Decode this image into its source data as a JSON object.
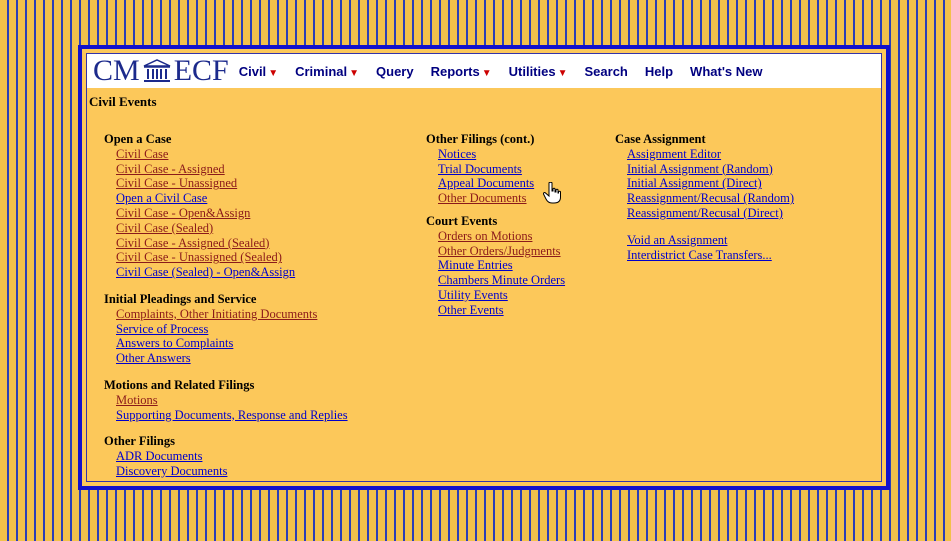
{
  "logo": {
    "left_text": "CM",
    "right_text": "ECF"
  },
  "menu": [
    {
      "label": "Civil",
      "has_caret": true
    },
    {
      "label": "Criminal",
      "has_caret": true
    },
    {
      "label": "Query",
      "has_caret": false
    },
    {
      "label": "Reports",
      "has_caret": true
    },
    {
      "label": "Utilities",
      "has_caret": true
    },
    {
      "label": "Search",
      "has_caret": false
    },
    {
      "label": "Help",
      "has_caret": false
    },
    {
      "label": "What's New",
      "has_caret": false
    }
  ],
  "page_title": "Civil Events",
  "col1": {
    "open_case": {
      "heading": "Open a Case",
      "links": [
        "Civil Case",
        "Civil Case - Assigned",
        "Civil Case - Unassigned",
        "Open a Civil Case",
        "Civil Case - Open&Assign",
        "Civil Case (Sealed)",
        "Civil Case - Assigned (Sealed)",
        "Civil Case - Unassigned (Sealed)",
        "Civil Case (Sealed) - Open&Assign"
      ]
    },
    "pleadings": {
      "heading": "Initial Pleadings and Service",
      "links": [
        "Complaints, Other Initiating Documents",
        "Service of Process",
        "Answers to Complaints",
        "Other Answers"
      ]
    },
    "motions": {
      "heading": "Motions and Related Filings",
      "links": [
        "Motions",
        "Supporting Documents, Response and Replies"
      ]
    },
    "other_filings": {
      "heading": "Other Filings",
      "links": [
        "ADR Documents",
        "Discovery Documents"
      ]
    }
  },
  "col2": {
    "other_filings_cont": {
      "heading": "Other Filings (cont.)",
      "links": [
        "Notices",
        "Trial Documents",
        "Appeal Documents",
        "Other Documents"
      ]
    },
    "court_events": {
      "heading": "Court Events",
      "links": [
        "Orders on Motions",
        "Other Orders/Judgments",
        "Minute Entries",
        "Chambers Minute Orders",
        "Utility Events",
        "Other Events"
      ]
    }
  },
  "col3": {
    "case_assignment": {
      "heading": "Case Assignment",
      "links": [
        "Assignment Editor",
        "Initial Assignment (Random)",
        "Initial Assignment (Direct)",
        "Reassignment/Recusal (Random)",
        "Reassignment/Recusal (Direct)"
      ],
      "links2": [
        "Void an Assignment",
        "Interdistrict Case Transfers..."
      ]
    }
  },
  "colors": {
    "link": "#0000cc",
    "visited": "#8b1a1a",
    "panel_bg": "#fcc85a",
    "frame_border": "#1111cc"
  }
}
